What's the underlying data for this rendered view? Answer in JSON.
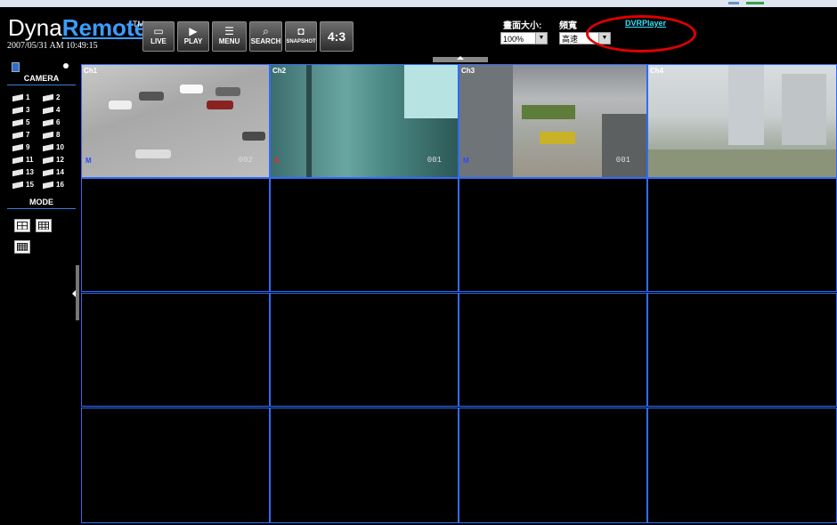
{
  "app": {
    "brand_prefix": "Dyna",
    "brand_main": "Remote",
    "trademark": "TM",
    "datetime": "2007/05/31 AM 10:49:15"
  },
  "toolbar": {
    "buttons": [
      {
        "label": "LIVE",
        "icon": "tv-icon"
      },
      {
        "label": "PLAY",
        "icon": "play-icon"
      },
      {
        "label": "MENU",
        "icon": "menu-icon"
      },
      {
        "label": "SEARCH",
        "icon": "search-icon"
      },
      {
        "label": "SNAPSHOT",
        "icon": "camera-icon"
      }
    ],
    "ratio_label": "4:3"
  },
  "settings": {
    "size_label": "畫面大小:",
    "size_value": "100%",
    "bandwidth_label": "頻寬",
    "bandwidth_value": "高速",
    "player_link": "DVRPlayer"
  },
  "sidebar": {
    "camera_heading": "CAMERA",
    "cameras": [
      "1",
      "2",
      "3",
      "4",
      "5",
      "6",
      "7",
      "8",
      "9",
      "10",
      "11",
      "12",
      "13",
      "14",
      "15",
      "16"
    ],
    "mode_heading": "MODE"
  },
  "grid": {
    "channels": [
      {
        "label": "Ch1",
        "badge": "M",
        "badge_color": "#2a4bff",
        "number": "002"
      },
      {
        "label": "Ch2",
        "badge": "A",
        "badge_color": "#ff2020",
        "number": "001"
      },
      {
        "label": "Ch3",
        "badge": "M",
        "badge_color": "#2a4bff",
        "number": "001"
      },
      {
        "label": "Ch4",
        "badge": "",
        "badge_color": "",
        "number": ""
      }
    ]
  },
  "colors": {
    "accent": "#3b9dff",
    "grid_line": "#2f6cff",
    "link": "#33e0ff",
    "highlight_circle": "#e00000"
  }
}
